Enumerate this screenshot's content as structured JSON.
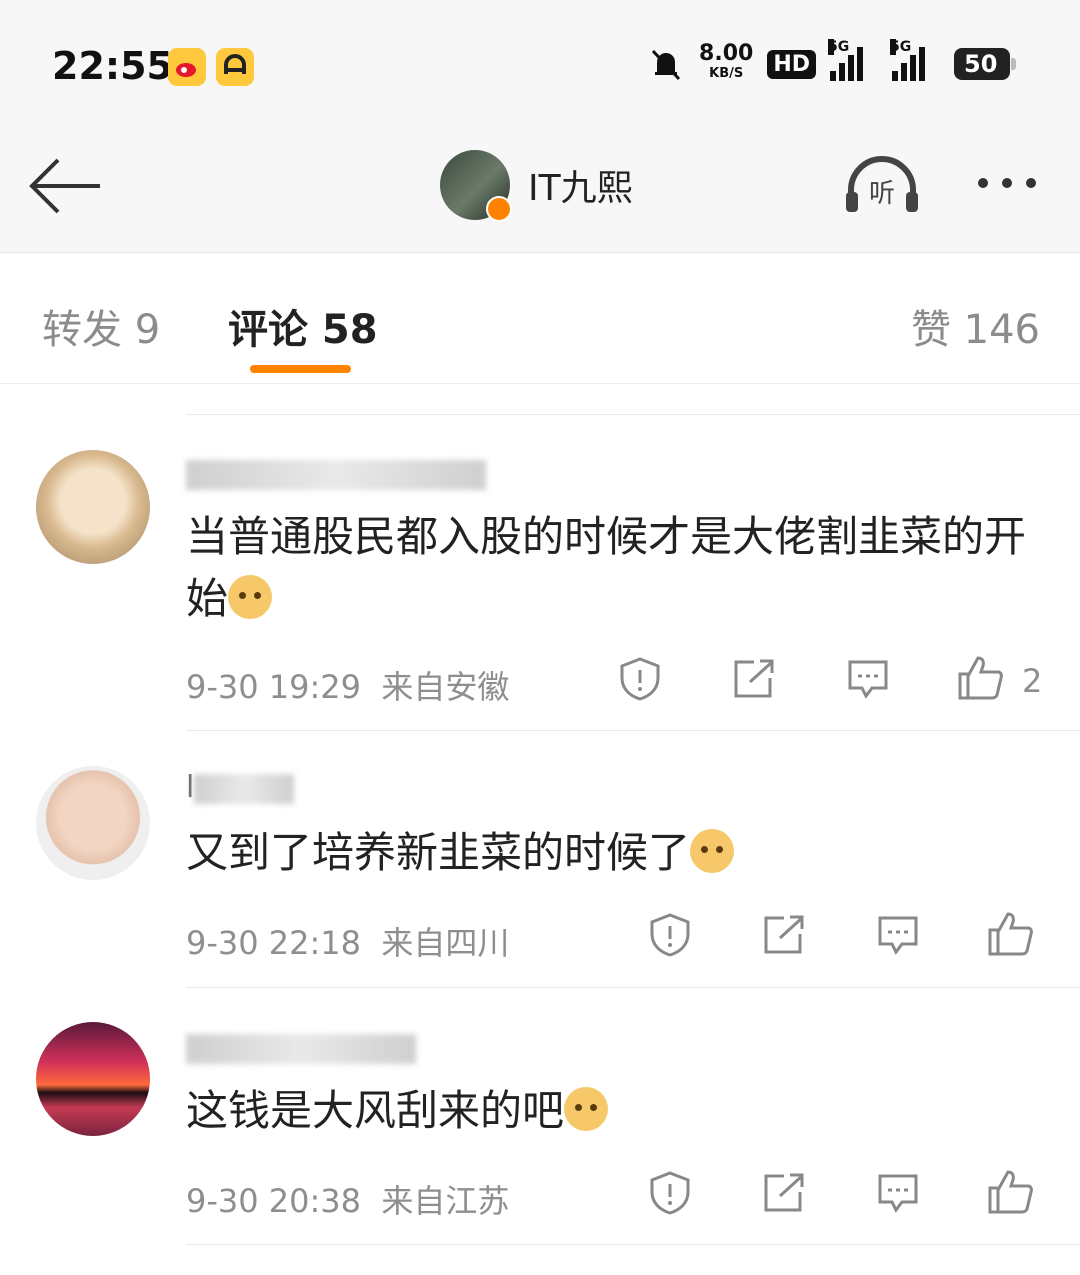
{
  "status_bar": {
    "time": "22:55",
    "net_speed": "8.00",
    "net_unit": "KB/S",
    "hd": "HD",
    "signal1_label": "5G",
    "signal2_label": "5G",
    "battery": "50"
  },
  "header": {
    "title": "IT九熙",
    "listen_label": "听"
  },
  "tabs": {
    "repost": "转发 9",
    "comment": "评论 58",
    "like": "赞 146"
  },
  "comments": [
    {
      "text": "当普通股民都入股的时候才是大佬割韭菜的开始",
      "time": "9-30 19:29",
      "location": "来自安徽",
      "likes": "2"
    },
    {
      "name_visible": "l",
      "text": "又到了培养新韭菜的时候了",
      "time": "9-30 22:18",
      "location": "来自四川"
    },
    {
      "text": "这钱是大风刮来的吧",
      "time": "9-30 20:38",
      "location": "来自江苏"
    }
  ],
  "colors": {
    "accent": "#ff8200",
    "text": "#222222",
    "muted": "#8e8e8e"
  }
}
